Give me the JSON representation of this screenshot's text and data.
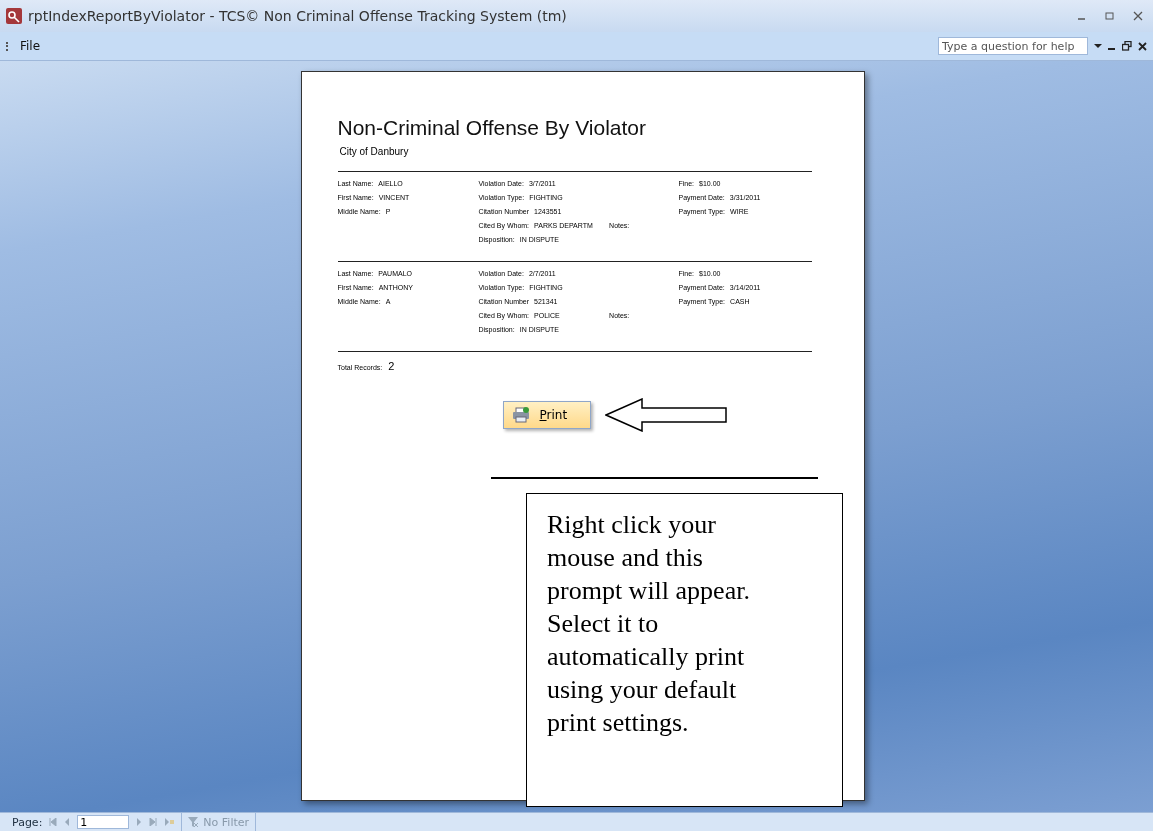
{
  "window": {
    "title": "rptIndexReportByViolator - TCS© Non Criminal Offense Tracking System (tm)"
  },
  "menu": {
    "items": [
      "File"
    ],
    "help_placeholder": "Type a question for help"
  },
  "report": {
    "title": "Non-Criminal Offense By Violator",
    "subtitle": "City of Danbury",
    "records": [
      {
        "person": [
          {
            "label": "Last Name:",
            "value": "AIELLO"
          },
          {
            "label": "First Name:",
            "value": "VINCENT"
          },
          {
            "label": "Middle Name:",
            "value": "P"
          }
        ],
        "violation": [
          {
            "label": "Violation Date:",
            "value": "3/7/2011"
          },
          {
            "label": "Violation Type:",
            "value": "FIGHTING"
          },
          {
            "label": "Citation Number",
            "value": "1243551"
          },
          {
            "label": "Cited By Whom:",
            "value": "PARKS DEPARTM",
            "note_label": "Notes:"
          },
          {
            "label": "Disposition:",
            "value": "IN DISPUTE"
          }
        ],
        "payment": [
          {
            "label": "Fine:",
            "value": "$10.00"
          },
          {
            "label": "Payment Date:",
            "value": "3/31/2011"
          },
          {
            "label": "Payment Type:",
            "value": "WIRE"
          }
        ]
      },
      {
        "person": [
          {
            "label": "Last Name:",
            "value": "PAUMALO"
          },
          {
            "label": "First Name:",
            "value": "ANTHONY"
          },
          {
            "label": "Middle Name:",
            "value": "A"
          }
        ],
        "violation": [
          {
            "label": "Violation Date:",
            "value": "2/7/2011"
          },
          {
            "label": "Violation Type:",
            "value": "FIGHTING"
          },
          {
            "label": "Citation Number",
            "value": "521341"
          },
          {
            "label": "Cited By Whom:",
            "value": "POLICE",
            "note_label": "Notes:"
          },
          {
            "label": "Disposition:",
            "value": "IN DISPUTE"
          }
        ],
        "payment": [
          {
            "label": "Fine:",
            "value": "$10.00"
          },
          {
            "label": "Payment Date:",
            "value": "3/14/2011"
          },
          {
            "label": "Payment Type:",
            "value": "CASH"
          }
        ]
      }
    ],
    "total_label": "Total Records:",
    "total_value": "2",
    "print_button": "Print"
  },
  "callout": {
    "text": "Right click your mouse and this prompt will appear. Select it to automatically print using your default print settings."
  },
  "status_bar": {
    "page_label": "Page:",
    "page_value": "1",
    "filter": "No Filter"
  }
}
